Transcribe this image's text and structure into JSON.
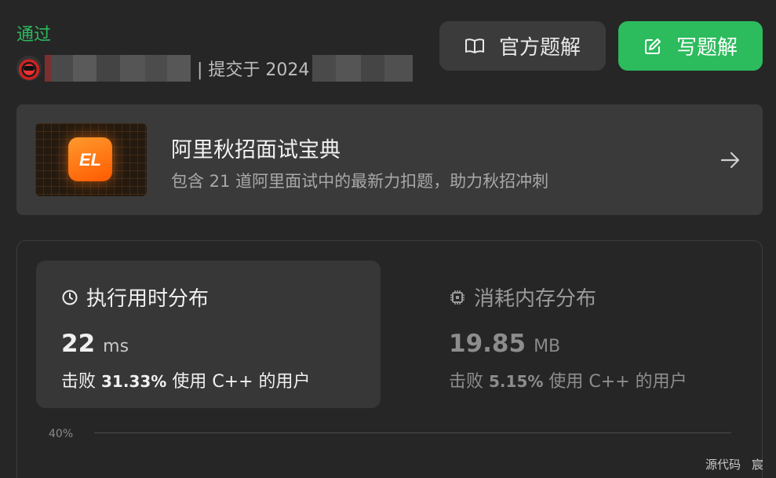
{
  "submission": {
    "status": "通过",
    "submitted_prefix": "| 提交于 2024",
    "status_color": "#2cbb5d"
  },
  "buttons": {
    "official_solution": "官方题解",
    "write_solution": "写题解",
    "official_icon": "book-open-icon",
    "write_icon": "edit-icon"
  },
  "promo": {
    "title": "阿里秋招面试宝典",
    "subtitle": "包含 21 道阿里面试中的最新力扣题，助力秋招冲刺",
    "logo_text": "EL",
    "logo_color": "#ff7a10"
  },
  "stats": {
    "runtime": {
      "title": "执行用时分布",
      "icon": "clock-icon",
      "value": "22",
      "unit": "ms",
      "beat_prefix": "击败",
      "beat_pct": "31.33%",
      "beat_suffix": "使用 C++ 的用户"
    },
    "memory": {
      "title": "消耗内存分布",
      "icon": "chip-icon",
      "value": "19.85",
      "unit": "MB",
      "beat_prefix": "击败",
      "beat_pct": "5.15%",
      "beat_suffix": "使用 C++ 的用户"
    }
  },
  "chart": {
    "axis_top_label": "40%"
  },
  "bottom_links": {
    "source_code": "源代码",
    "partial": "宸"
  }
}
